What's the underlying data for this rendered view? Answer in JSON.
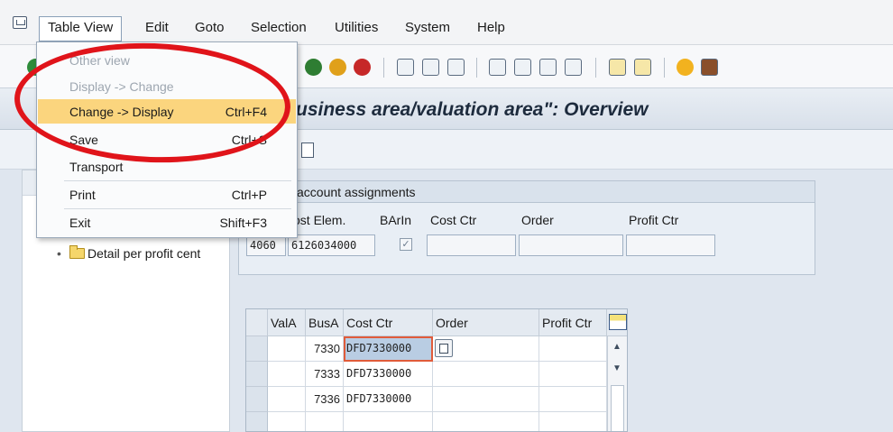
{
  "menubar": {
    "items": [
      "Table View",
      "Edit",
      "Goto",
      "Selection",
      "Utilities",
      "System",
      "Help"
    ]
  },
  "dropdown": {
    "items": [
      {
        "label": "Other view",
        "shortcut": "",
        "state": "disabled"
      },
      {
        "label": "Display -> Change",
        "shortcut": "",
        "state": "disabled"
      },
      {
        "label": "Change -> Display",
        "shortcut": "Ctrl+F4",
        "state": "highlighted"
      },
      {
        "label": "Save",
        "shortcut": "Ctrl+S",
        "state": "normal"
      },
      {
        "label": "Transport",
        "shortcut": "",
        "state": "normal"
      },
      {
        "label": "Print",
        "shortcut": "Ctrl+P",
        "state": "normal"
      },
      {
        "label": "Exit",
        "shortcut": "Shift+F3",
        "state": "normal"
      }
    ]
  },
  "screen": {
    "title": "usiness area/valuation area\": Overview"
  },
  "nav": {
    "node_label": "Detail per profit cent"
  },
  "assignments": {
    "title": "account assignments",
    "labels": {
      "cost_elem": "ost Elem.",
      "barin": "BArIn",
      "cost_ctr": "Cost Ctr",
      "order": "Order",
      "profit_ctr": "Profit Ctr"
    },
    "values": {
      "co_area": "4060",
      "cost_elem": "6126034000",
      "cost_ctr": "",
      "order": "",
      "profit_ctr": ""
    },
    "barin_checked": "✓"
  },
  "table": {
    "columns": [
      "ValA",
      "BusA",
      "Cost Ctr",
      "Order",
      "Profit Ctr"
    ],
    "rows": [
      {
        "vala": "",
        "busa": "7330",
        "cost_ctr": "DFD7330000",
        "order": "",
        "profit_ctr": ""
      },
      {
        "vala": "",
        "busa": "7333",
        "cost_ctr": "DFD7330000",
        "order": "",
        "profit_ctr": ""
      },
      {
        "vala": "",
        "busa": "7336",
        "cost_ctr": "DFD7330000",
        "order": "",
        "profit_ctr": ""
      }
    ]
  },
  "colors": {
    "highlight": "#fbd57e",
    "annotation": "#e0141a",
    "focus_cell": "#b9cde3"
  }
}
